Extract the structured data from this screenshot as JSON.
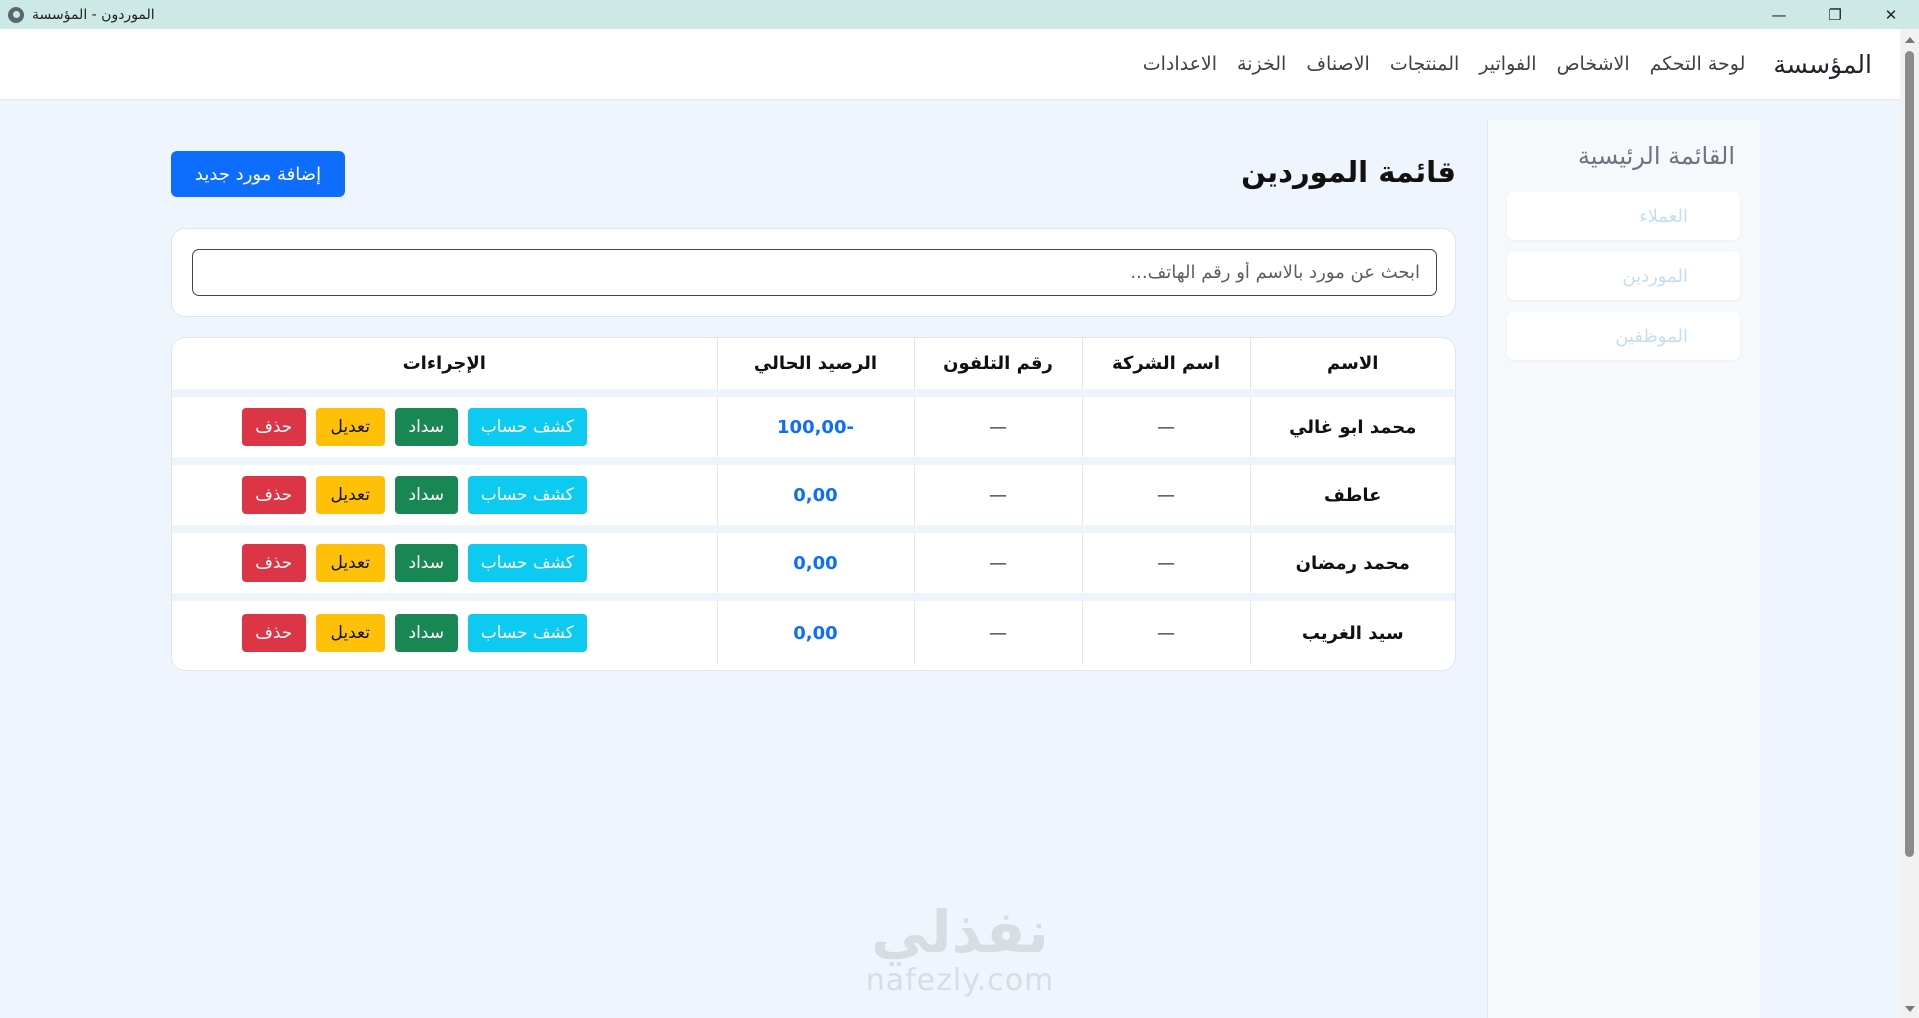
{
  "window": {
    "title": "الموردون - المؤسسة",
    "controls": {
      "minimize": "—",
      "restore": "❐",
      "close": "✕"
    }
  },
  "navbar": {
    "brand": "المؤسسة",
    "links": [
      "لوحة التحكم",
      "الاشخاص",
      "الفواتير",
      "المنتجات",
      "الاصناف",
      "الخزنة",
      "الاعدادات"
    ]
  },
  "sidebar": {
    "title": "القائمة الرئيسية",
    "items": [
      "العملاء",
      "الموردين",
      "الموظفين"
    ]
  },
  "main": {
    "title": "قائمة الموردين",
    "add_button": "إضافة مورد جديد",
    "search_placeholder": "ابحث عن مورد بالاسم أو رقم الهاتف...",
    "table": {
      "headers": [
        "الاسم",
        "اسم الشركة",
        "رقم التلفون",
        "الرصيد الحالي",
        "الإجراءات"
      ],
      "rows": [
        {
          "name": "محمد ابو غالي",
          "company": "—",
          "phone": "—",
          "balance": "-100,00"
        },
        {
          "name": "عاطف",
          "company": "—",
          "phone": "—",
          "balance": "0,00"
        },
        {
          "name": "محمد رمضان",
          "company": "—",
          "phone": "—",
          "balance": "0,00"
        },
        {
          "name": "سيد الغريب",
          "company": "—",
          "phone": "—",
          "balance": "0,00"
        }
      ],
      "actions": {
        "statement": "كشف حساب",
        "pay": "سداد",
        "edit": "تعديل",
        "delete": "حذف"
      }
    }
  },
  "watermark": {
    "arabic": "نفذلي",
    "latin": "nafezly.com"
  },
  "colors": {
    "primary": "#0d6efd",
    "info": "#0dcaf0",
    "success": "#198754",
    "warning": "#ffc107",
    "danger": "#dc3545",
    "titlebar": "#cde9e6"
  }
}
